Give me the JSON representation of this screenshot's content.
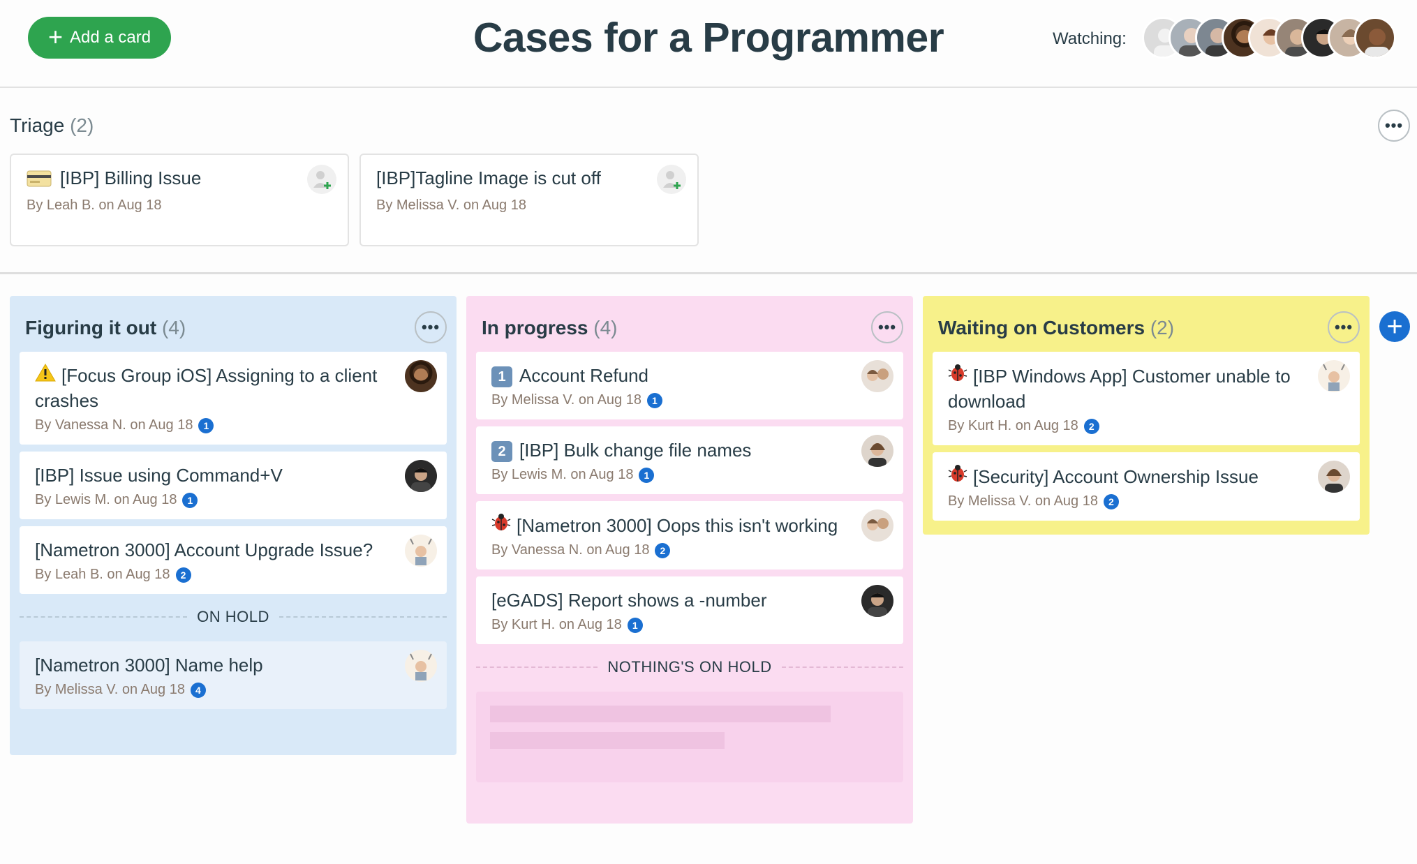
{
  "header": {
    "add_card_label": "Add a card",
    "title": "Cases for a Programmer",
    "watching_label": "Watching:",
    "watchers": [
      {
        "name": "watcher-1",
        "color": "#d8d8d8"
      },
      {
        "name": "watcher-2",
        "color": "#8f9aa3"
      },
      {
        "name": "watcher-3",
        "color": "#7a8088"
      },
      {
        "name": "watcher-4",
        "color": "#5b3a22"
      },
      {
        "name": "watcher-5",
        "color": "#e6c9b5"
      },
      {
        "name": "watcher-6",
        "color": "#9a8c80"
      },
      {
        "name": "watcher-7",
        "color": "#2d2d2d"
      },
      {
        "name": "watcher-8",
        "color": "#c9b8a8"
      },
      {
        "name": "watcher-9",
        "color": "#6b4a2f"
      }
    ]
  },
  "triage": {
    "title": "Triage",
    "count": "(2)",
    "cards": [
      {
        "title": "[IBP] Billing Issue",
        "icon": "credit-card-icon",
        "byline": "By Leah B. on Aug 18"
      },
      {
        "title": "[IBP]Tagline Image is cut off",
        "byline": "By Melissa V. on Aug 18"
      }
    ]
  },
  "columns": {
    "figuring": {
      "title": "Figuring it out",
      "count": "(4)",
      "cards": [
        {
          "title": "[Focus Group iOS] Assigning to a client crashes",
          "icon": "warning-icon",
          "byline": "By Vanessa N. on Aug 18",
          "badge": "1"
        },
        {
          "title": "[IBP] Issue using Command+V",
          "byline": "By Lewis M. on Aug 18",
          "badge": "1"
        },
        {
          "title": "[Nametron 3000] Account Upgrade Issue?",
          "byline": "By Leah B. on Aug 18",
          "badge": "2"
        }
      ],
      "hold_label": "ON HOLD",
      "hold_cards": [
        {
          "title": "[Nametron 3000] Name help",
          "byline": "By Melissa V. on Aug 18",
          "badge": "4"
        }
      ]
    },
    "progress": {
      "title": "In progress",
      "count": "(4)",
      "cards": [
        {
          "title": "Account Refund",
          "key": "1",
          "byline": "By Melissa V. on Aug 18",
          "badge": "1"
        },
        {
          "title": "[IBP] Bulk change file names",
          "key": "2",
          "byline": "By Lewis M. on Aug 18",
          "badge": "1"
        },
        {
          "title": "[Nametron 3000] Oops this isn't working",
          "icon": "bug-icon",
          "byline": "By Vanessa N. on Aug 18",
          "badge": "2"
        },
        {
          "title": "[eGADS] Report shows a -number",
          "byline": "By Kurt H. on Aug 18",
          "badge": "1"
        }
      ],
      "hold_label": "NOTHING'S ON HOLD"
    },
    "waiting": {
      "title": "Waiting on Customers",
      "count": "(2)",
      "cards": [
        {
          "title": "[IBP Windows App] Customer unable to download",
          "icon": "bug-icon",
          "byline": "By Kurt H. on Aug 18",
          "badge": "2"
        },
        {
          "title": "[Security] Account Ownership Issue",
          "icon": "bug-icon",
          "byline": "By Melissa V. on Aug 18",
          "badge": "2"
        }
      ]
    }
  },
  "colors": {
    "add_button": "#2ea44f",
    "blue_column": "#d9e9f8",
    "pink_column": "#fbdcf1",
    "yellow_column": "#f7f18a",
    "badge": "#1a6fd1"
  }
}
